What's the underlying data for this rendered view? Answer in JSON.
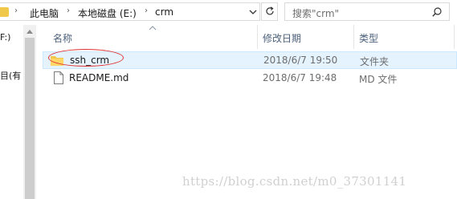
{
  "address_bar": {
    "breadcrumbs": [
      "此电脑",
      "本地磁盘 (E:)",
      "crm"
    ],
    "separator_glyph": "›"
  },
  "search": {
    "placeholder": "搜索\"crm\""
  },
  "nav_pane": {
    "items": [
      "F:)",
      "目(有"
    ]
  },
  "columns": {
    "name": "名称",
    "modified": "修改日期",
    "type": "类型"
  },
  "files": [
    {
      "name": "ssh_crm",
      "modified": "2018/6/7 19:50",
      "type": "文件夹",
      "icon": "folder-icon"
    },
    {
      "name": "README.md",
      "modified": "2018/6/7 19:48",
      "type": "MD 文件",
      "icon": "file-icon"
    }
  ],
  "watermark": "https://blog.csdn.net/m0_37301141",
  "colors": {
    "folder": "#f0c94a",
    "selection": "#e5f3ff",
    "annotation": "#e03030",
    "header_text": "#4c607a"
  }
}
